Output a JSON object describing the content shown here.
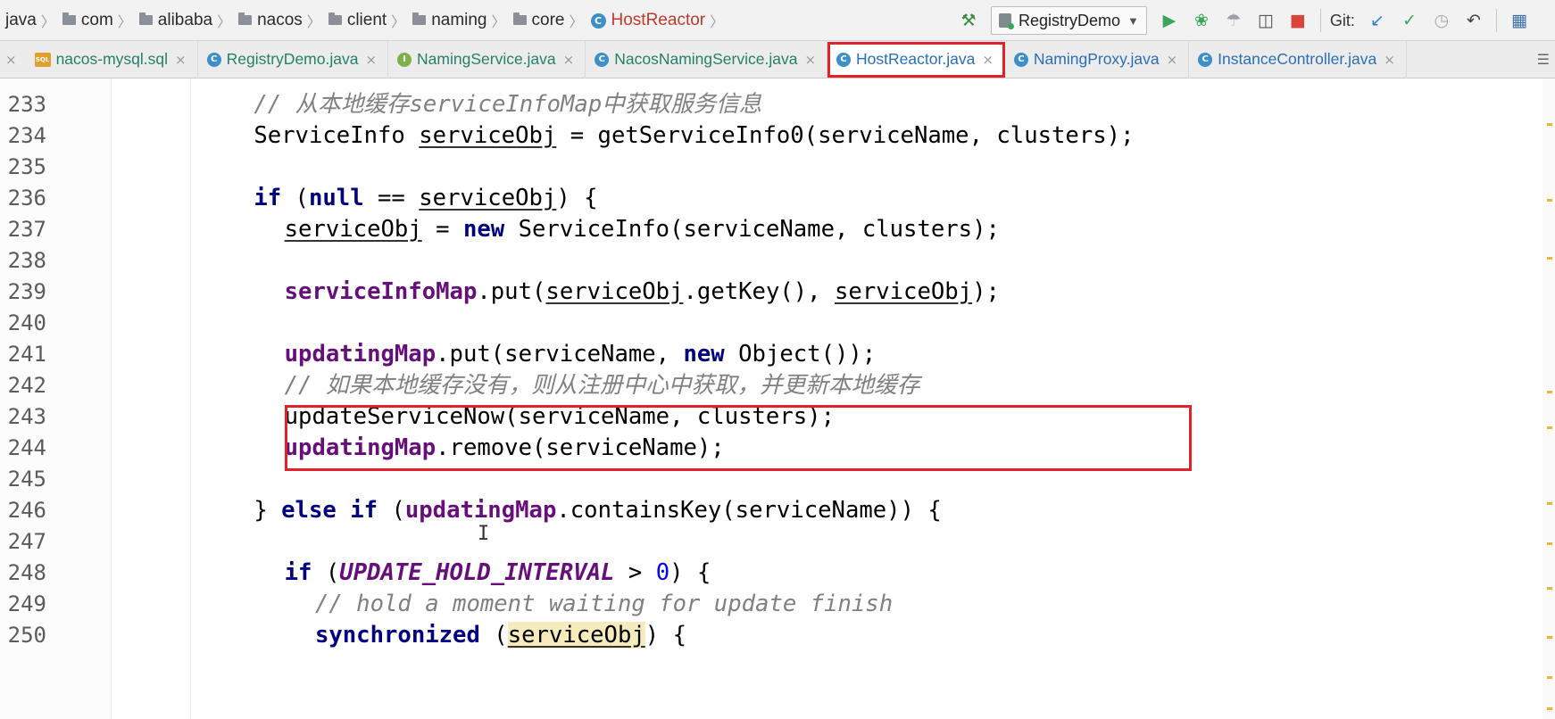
{
  "breadcrumb": {
    "items": [
      {
        "label": "java",
        "kind": "plain"
      },
      {
        "label": "com",
        "kind": "folder"
      },
      {
        "label": "alibaba",
        "kind": "folder"
      },
      {
        "label": "nacos",
        "kind": "folder"
      },
      {
        "label": "client",
        "kind": "folder"
      },
      {
        "label": "naming",
        "kind": "folder"
      },
      {
        "label": "core",
        "kind": "folder"
      },
      {
        "label": "HostReactor",
        "kind": "class"
      }
    ]
  },
  "toolbar": {
    "run_config": "RegistryDemo",
    "git_label": "Git:",
    "icons": [
      "build-hammer-icon",
      "run-icon",
      "debug-icon",
      "coverage-icon",
      "profile-icon",
      "stop-icon",
      "git-update-icon",
      "git-commit-icon",
      "git-history-icon",
      "git-rollback-icon",
      "project-structure-icon"
    ]
  },
  "tabs": [
    {
      "label": "nacos-mysql.sql",
      "icon": "sql-file-icon",
      "icon_text": "SQL",
      "active": false
    },
    {
      "label": "RegistryDemo.java",
      "icon": "class-icon",
      "icon_text": "C",
      "active": false
    },
    {
      "label": "NamingService.java",
      "icon": "interface-icon",
      "icon_text": "I",
      "active": false
    },
    {
      "label": "NacosNamingService.java",
      "icon": "class-icon",
      "icon_text": "C",
      "active": false
    },
    {
      "label": "HostReactor.java",
      "icon": "class-icon",
      "icon_text": "C",
      "active": true
    },
    {
      "label": "NamingProxy.java",
      "icon": "class-icon",
      "icon_text": "C",
      "active": false
    },
    {
      "label": "InstanceController.java",
      "icon": "class-icon",
      "icon_text": "C",
      "active": false
    }
  ],
  "tab_close_glyph": "×",
  "class_glyph": "C",
  "tab_menu_glyph": "☰",
  "editor": {
    "top_partial_line": "232",
    "lines": [
      {
        "n": "233",
        "indent": 2,
        "tokens": [
          {
            "t": "// 从本地缓存serviceInfoMap中获取服务信息",
            "c": "cm"
          }
        ]
      },
      {
        "n": "234",
        "indent": 2,
        "tokens": [
          {
            "t": "ServiceInfo "
          },
          {
            "t": "serviceObj",
            "c": "ul"
          },
          {
            "t": " = getServiceInfo0(serviceName, clusters);"
          }
        ]
      },
      {
        "n": "235",
        "indent": 0,
        "tokens": []
      },
      {
        "n": "236",
        "indent": 2,
        "tokens": [
          {
            "t": "if",
            "c": "kw"
          },
          {
            "t": " ("
          },
          {
            "t": "null",
            "c": "kw"
          },
          {
            "t": " == "
          },
          {
            "t": "serviceObj",
            "c": "ul"
          },
          {
            "t": ") {"
          }
        ]
      },
      {
        "n": "237",
        "indent": 4,
        "tokens": [
          {
            "t": "serviceObj",
            "c": "ul"
          },
          {
            "t": " = "
          },
          {
            "t": "new",
            "c": "kw"
          },
          {
            "t": " ServiceInfo(serviceName, clusters);"
          }
        ]
      },
      {
        "n": "238",
        "indent": 0,
        "tokens": []
      },
      {
        "n": "239",
        "indent": 4,
        "tokens": [
          {
            "t": "serviceInfoMap",
            "c": "fld"
          },
          {
            "t": ".put("
          },
          {
            "t": "serviceObj",
            "c": "ul"
          },
          {
            "t": ".getKey(), "
          },
          {
            "t": "serviceObj",
            "c": "ul"
          },
          {
            "t": ");"
          }
        ]
      },
      {
        "n": "240",
        "indent": 0,
        "tokens": []
      },
      {
        "n": "241",
        "indent": 4,
        "tokens": [
          {
            "t": "updatingMap",
            "c": "fld"
          },
          {
            "t": ".put(serviceName, "
          },
          {
            "t": "new",
            "c": "kw"
          },
          {
            "t": " Object());"
          }
        ]
      },
      {
        "n": "242",
        "indent": 4,
        "tokens": [
          {
            "t": "// 如果本地缓存没有，则从注册中心中获取，并更新本地缓存",
            "c": "cm"
          }
        ]
      },
      {
        "n": "243",
        "indent": 4,
        "tokens": [
          {
            "t": "updateServiceNow(serviceName, clusters);"
          }
        ]
      },
      {
        "n": "244",
        "indent": 4,
        "tokens": [
          {
            "t": "updatingMap",
            "c": "fld"
          },
          {
            "t": ".remove(serviceName);"
          }
        ]
      },
      {
        "n": "245",
        "indent": 0,
        "tokens": []
      },
      {
        "n": "246",
        "indent": 2,
        "tokens": [
          {
            "t": "} "
          },
          {
            "t": "else",
            "c": "kw"
          },
          {
            "t": " "
          },
          {
            "t": "if",
            "c": "kw"
          },
          {
            "t": " ("
          },
          {
            "t": "updatingMap",
            "c": "fld"
          },
          {
            "t": ".containsKey(serviceName)) {"
          }
        ]
      },
      {
        "n": "247",
        "indent": 0,
        "tokens": []
      },
      {
        "n": "248",
        "indent": 4,
        "tokens": [
          {
            "t": "if",
            "c": "kw"
          },
          {
            "t": " ("
          },
          {
            "t": "UPDATE_HOLD_INTERVAL",
            "c": "cst"
          },
          {
            "t": " > "
          },
          {
            "t": "0",
            "c": "num"
          },
          {
            "t": ") {"
          }
        ]
      },
      {
        "n": "249",
        "indent": 6,
        "tokens": [
          {
            "t": "// hold a moment waiting for update finish",
            "c": "cm"
          }
        ]
      },
      {
        "n": "250",
        "indent": 6,
        "tokens": [
          {
            "t": "synchronized",
            "c": "kw"
          },
          {
            "t": " ("
          },
          {
            "t": "serviceObj",
            "c": "ul hl"
          },
          {
            "t": ") {"
          }
        ]
      }
    ]
  },
  "text_cursor_glyph": "I"
}
